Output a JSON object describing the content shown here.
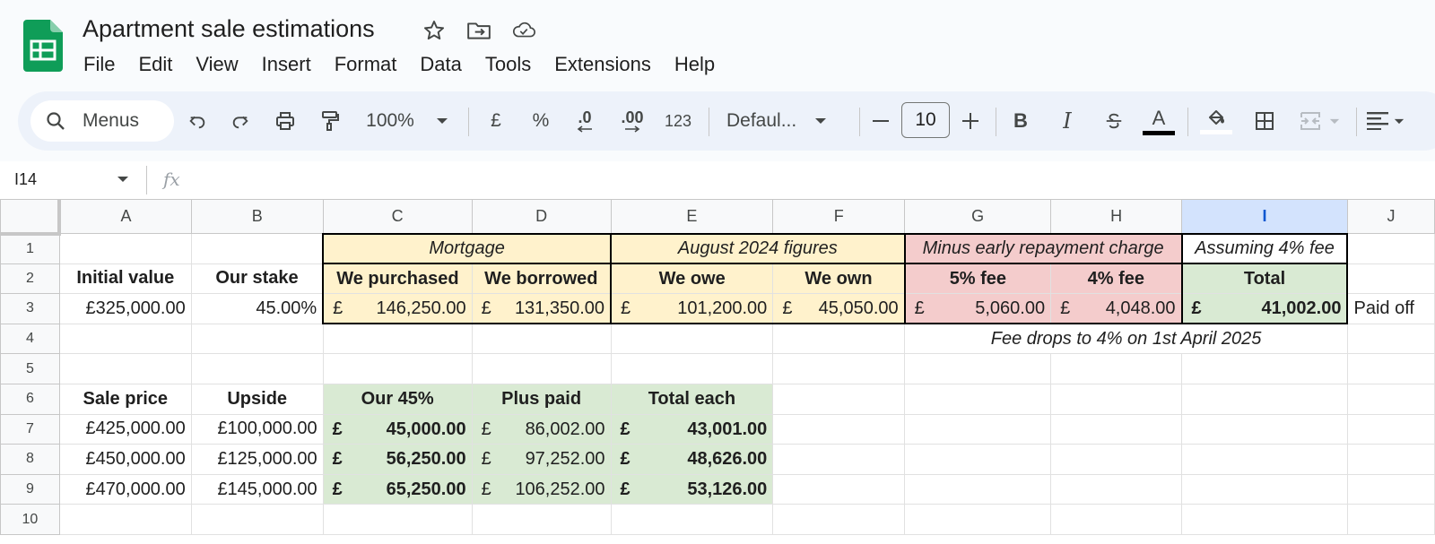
{
  "app": {
    "title": "Apartment sale estimations",
    "brand_color": "#0f9d58",
    "title_icons": [
      "star-icon",
      "move-to-folder-icon",
      "cloud-saved-icon"
    ]
  },
  "menu": [
    "File",
    "Edit",
    "View",
    "Insert",
    "Format",
    "Data",
    "Tools",
    "Extensions",
    "Help"
  ],
  "toolbar": {
    "search_placeholder": "Menus",
    "zoom": "100%",
    "currency": "£",
    "percent": "%",
    "decrease_decimals": ".0",
    "increase_decimals": ".00",
    "more_formats": "123",
    "font": "Defaul...",
    "font_size": "10",
    "bold": "B",
    "italic": "I",
    "text_color_letter": "A",
    "icons": [
      "search-icon",
      "undo-icon",
      "redo-icon",
      "print-icon",
      "paint-format-icon",
      "zoom-dropdown-icon",
      "font-dropdown-icon",
      "decrease-font-size-icon",
      "increase-font-size-icon",
      "strikethrough-icon",
      "text-color-icon",
      "fill-color-icon",
      "borders-icon",
      "merge-cells-icon",
      "horizontal-align-icon"
    ]
  },
  "formula_bar": {
    "cell_ref": "I14",
    "fx": "fx",
    "value": ""
  },
  "columns": [
    "A",
    "B",
    "C",
    "D",
    "E",
    "F",
    "G",
    "H",
    "I",
    "J"
  ],
  "selected_column": "I",
  "rows": [
    "1",
    "2",
    "3",
    "4",
    "5",
    "6",
    "7",
    "8",
    "9",
    "10"
  ],
  "sheet": {
    "headers": {
      "mortgage": "Mortgage",
      "august": "August 2024 figures",
      "minus_erc": "Minus early repayment charge",
      "assuming": "Assuming 4% fee"
    },
    "row2": [
      "Initial value",
      "Our stake",
      "We purchased",
      "We borrowed",
      "We owe",
      "We own",
      "5% fee",
      "4% fee",
      "Total"
    ],
    "row3": {
      "initial_value": "£325,000.00",
      "our_stake": "45.00%",
      "purchased": "146,250.00",
      "borrowed": "131,350.00",
      "owe": "101,200.00",
      "own": "45,050.00",
      "fee5": "5,060.00",
      "fee4": "4,048.00",
      "total": "41,002.00",
      "note": "Paid off"
    },
    "currency_symbol": "£",
    "fee_note": "Fee drops to 4% on 1st April 2025",
    "row6": [
      "Sale price",
      "Upside",
      "Our 45%",
      "Plus paid",
      "Total each"
    ],
    "sales": [
      {
        "sale_price": "£425,000.00",
        "upside": "£100,000.00",
        "our45": "45,000.00",
        "plus_paid": "86,002.00",
        "total_each": "43,001.00"
      },
      {
        "sale_price": "£450,000.00",
        "upside": "£125,000.00",
        "our45": "56,250.00",
        "plus_paid": "97,252.00",
        "total_each": "48,626.00"
      },
      {
        "sale_price": "£470,000.00",
        "upside": "£145,000.00",
        "our45": "65,250.00",
        "plus_paid": "106,252.00",
        "total_each": "53,126.00"
      }
    ],
    "fill_colors": {
      "yellow": "#fff2cc",
      "red": "#f4cccc",
      "green": "#d9ead3"
    }
  }
}
